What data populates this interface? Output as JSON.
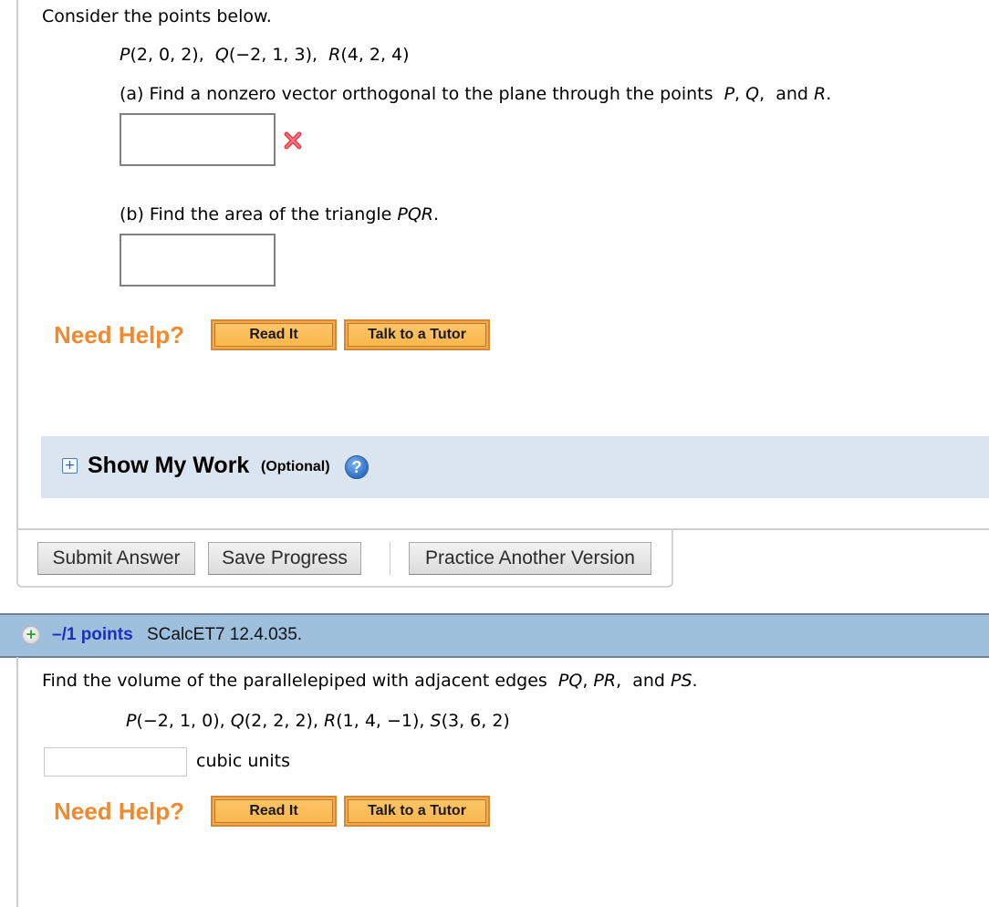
{
  "question1": {
    "intro": "Consider the points below.",
    "points": [
      {
        "name": "P",
        "coords": "(2, 0, 2)"
      },
      {
        "name": "Q",
        "coords": "(−2, 1, 3)"
      },
      {
        "name": "R",
        "coords": "(4, 2, 4)"
      }
    ],
    "part_a": {
      "prefix": "(a) Find a nonzero vector orthogonal to the plane through the points ",
      "v1": "P",
      "v2": "Q",
      "and": "and",
      "v3": "R",
      "answer_value": "",
      "status_icon": "wrong-x-icon"
    },
    "part_b": {
      "prefix": "(b) Find the area of the triangle ",
      "var": "PQR",
      "answer_value": ""
    },
    "help": {
      "label": "Need Help?",
      "read_it": "Read It",
      "tutor": "Talk to a Tutor"
    },
    "show_my_work": {
      "title": "Show My Work",
      "optional": "(Optional)",
      "help_icon": "?"
    },
    "actions": {
      "submit": "Submit Answer",
      "save": "Save Progress",
      "practice": "Practice Another Version"
    }
  },
  "question2": {
    "header": {
      "points": "–/1 points",
      "id": "SCalcET7 12.4.035."
    },
    "prompt_prefix": "Find the volume of the parallelepiped with adjacent edges ",
    "edges": [
      "PQ",
      "PR",
      "PS"
    ],
    "and": "and",
    "points": [
      {
        "name": "P",
        "coords": "(−2, 1, 0)"
      },
      {
        "name": "Q",
        "coords": "(2, 2, 2)"
      },
      {
        "name": "R",
        "coords": "(1, 4, −1)"
      },
      {
        "name": "S",
        "coords": "(3, 6, 2)"
      }
    ],
    "answer_value": "",
    "units": "cubic units",
    "help": {
      "label": "Need Help?",
      "read_it": "Read It",
      "tutor": "Talk to a Tutor"
    }
  },
  "colors": {
    "need_help": "#f0892f",
    "points_link": "#1b2fbf",
    "header_bg": "#9fc0dd",
    "show_my_work_bg": "#dbe5ef",
    "wrong": "#e8394a"
  }
}
